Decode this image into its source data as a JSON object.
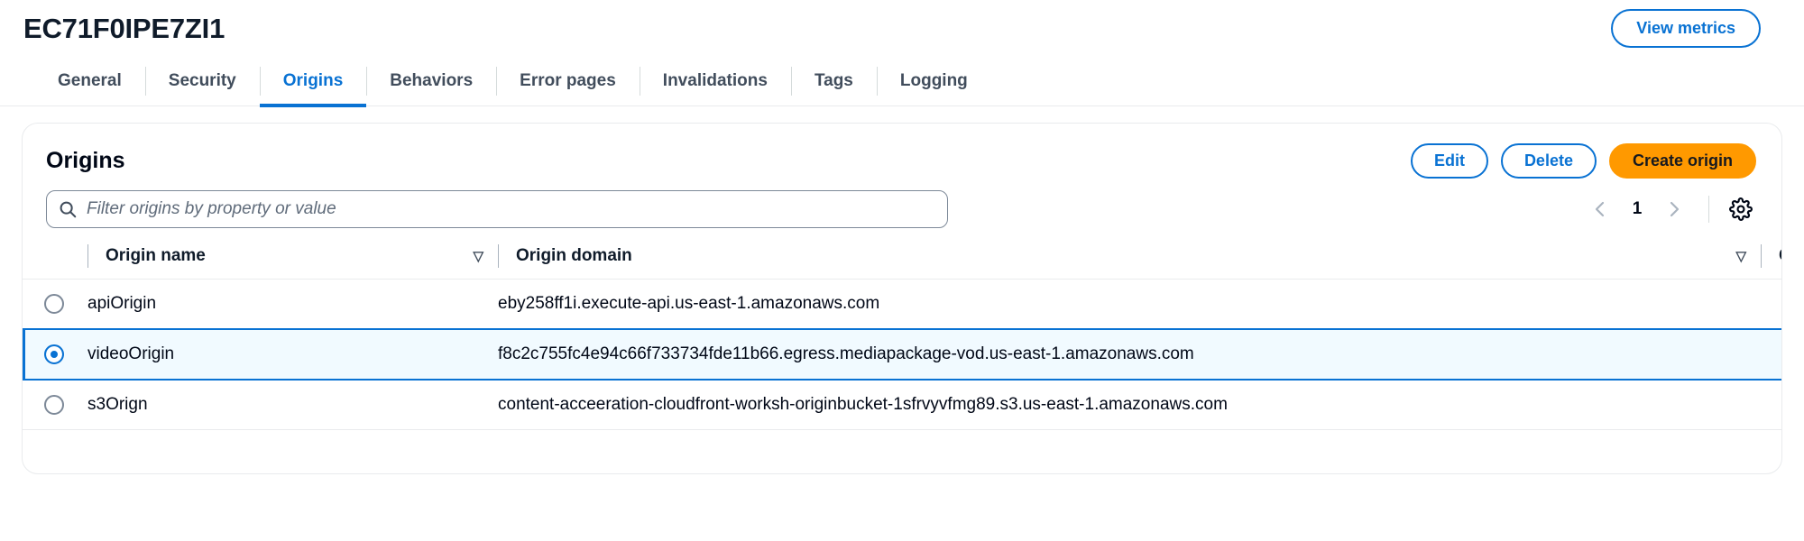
{
  "header": {
    "title": "EC71F0IPE7ZI1",
    "view_metrics_label": "View metrics"
  },
  "tabs": [
    {
      "label": "General",
      "active": false
    },
    {
      "label": "Security",
      "active": false
    },
    {
      "label": "Origins",
      "active": true
    },
    {
      "label": "Behaviors",
      "active": false
    },
    {
      "label": "Error pages",
      "active": false
    },
    {
      "label": "Invalidations",
      "active": false
    },
    {
      "label": "Tags",
      "active": false
    },
    {
      "label": "Logging",
      "active": false
    }
  ],
  "panel": {
    "title": "Origins",
    "edit_label": "Edit",
    "delete_label": "Delete",
    "create_label": "Create origin"
  },
  "filter": {
    "placeholder": "Filter origins by property or value",
    "search_icon": "search-icon"
  },
  "pagination": {
    "prev_icon": "chevron-left-icon",
    "next_icon": "chevron-right-icon",
    "current_page": "1",
    "settings_icon": "gear-icon"
  },
  "table": {
    "columns": [
      {
        "label": "Origin name",
        "sortable": true,
        "sort_icon": "sort-descending-icon"
      },
      {
        "label": "Origin domain",
        "sortable": true,
        "sort_icon": "sort-descending-icon"
      },
      {
        "label": "C",
        "sortable": false,
        "sort_icon": ""
      }
    ],
    "rows": [
      {
        "selected": false,
        "origin_name": "apiOrigin",
        "origin_domain": "eby258ff1i.execute-api.us-east-1.amazonaws.com"
      },
      {
        "selected": true,
        "origin_name": "videoOrigin",
        "origin_domain": "f8c2c755fc4e94c66f733734fde11b66.egress.mediapackage-vod.us-east-1.amazonaws.com"
      },
      {
        "selected": false,
        "origin_name": "s3Orign",
        "origin_domain": "content-acceeration-cloudfront-worksh-originbucket-1sfrvyvfmg89.s3.us-east-1.amazonaws.com"
      }
    ]
  },
  "colors": {
    "accent_blue": "#0972d3",
    "primary_orange": "#ff9900",
    "selected_row_bg": "#f1faff",
    "border": "#e9ebed"
  }
}
